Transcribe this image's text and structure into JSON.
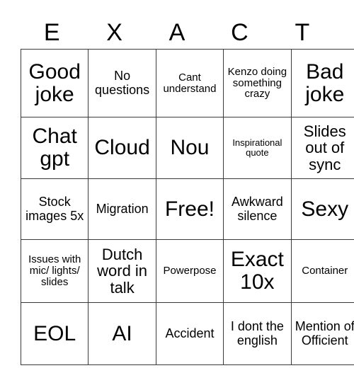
{
  "card": {
    "title_letters": [
      "E",
      "X",
      "A",
      "C",
      "T"
    ],
    "grid": {
      "columns": 5,
      "rows": 5,
      "cells": [
        [
          {
            "text": "Good joke",
            "size": "xxl"
          },
          {
            "text": "No questions",
            "size": "m"
          },
          {
            "text": "Cant understand",
            "size": "s"
          },
          {
            "text": "Kenzo doing something crazy",
            "size": "s"
          },
          {
            "text": "Bad joke",
            "size": "xxl"
          }
        ],
        [
          {
            "text": "Chat gpt",
            "size": "xxl"
          },
          {
            "text": "Cloud",
            "size": "xxl"
          },
          {
            "text": "Nou",
            "size": "xxl"
          },
          {
            "text": "Inspirational quote",
            "size": "xs"
          },
          {
            "text": "Slides out of sync",
            "size": "l"
          }
        ],
        [
          {
            "text": "Stock images 5x",
            "size": "m"
          },
          {
            "text": "Migration",
            "size": "m"
          },
          {
            "text": "Free!",
            "size": "xxl"
          },
          {
            "text": "Awkward silence",
            "size": "m"
          },
          {
            "text": "Sexy",
            "size": "xxl"
          }
        ],
        [
          {
            "text": "Issues with mic/ lights/ slides",
            "size": "s"
          },
          {
            "text": "Dutch word in talk",
            "size": "l"
          },
          {
            "text": "Powerpose",
            "size": "s"
          },
          {
            "text": "Exact 10x",
            "size": "xxl"
          },
          {
            "text": "Container",
            "size": "s"
          }
        ],
        [
          {
            "text": "EOL",
            "size": "xxl"
          },
          {
            "text": "AI",
            "size": "xxl"
          },
          {
            "text": "Accident",
            "size": "m"
          },
          {
            "text": "I dont the english",
            "size": "m"
          },
          {
            "text": "Mention of Officient",
            "size": "m"
          }
        ]
      ]
    },
    "colors": {
      "background": "#ffffff",
      "text": "#000000",
      "grid_line": "#3a3a3a"
    }
  }
}
